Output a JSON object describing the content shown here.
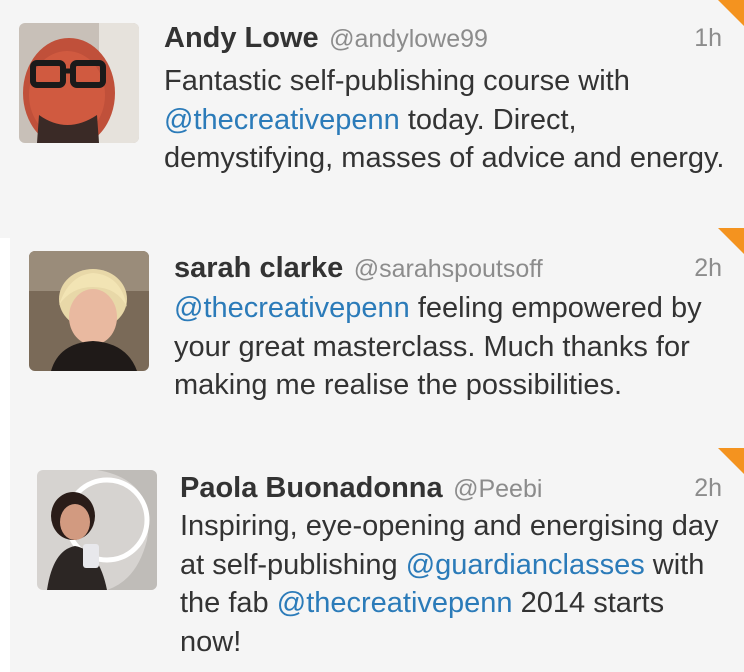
{
  "tweets": [
    {
      "name": "Andy Lowe",
      "handle": "@andylowe99",
      "time": "1h",
      "text": [
        {
          "type": "text",
          "value": "Fantastic self-publishing course with "
        },
        {
          "type": "mention",
          "value": "@thecreativepenn"
        },
        {
          "type": "text",
          "value": " today. Direct, demystifying, masses of advice and energy."
        }
      ]
    },
    {
      "name": "sarah clarke",
      "handle": "@sarahspoutsoff",
      "time": "2h",
      "text": [
        {
          "type": "mention",
          "value": "@thecreativepenn"
        },
        {
          "type": "text",
          "value": " feeling empowered by your great masterclass. Much thanks for making me realise the possibilities."
        }
      ]
    },
    {
      "name": "Paola Buonadonna",
      "handle": "@Peebi",
      "time": "2h",
      "text": [
        {
          "type": "text",
          "value": "Inspiring, eye-opening and energising day at self-publishing "
        },
        {
          "type": "mention",
          "value": "@guardianclasses"
        },
        {
          "type": "text",
          "value": " with the fab "
        },
        {
          "type": "mention",
          "value": "@thecreativepenn"
        },
        {
          "type": "text",
          "value": " 2014 starts now!"
        }
      ]
    }
  ],
  "colors": {
    "card_background": "#f5f5f5",
    "name": "#333333",
    "meta": "#8c8c8c",
    "mention": "#2b7bb9",
    "corner_accent": "#f4931f"
  },
  "icons": {
    "corner": "orange-corner-triangle-icon"
  }
}
